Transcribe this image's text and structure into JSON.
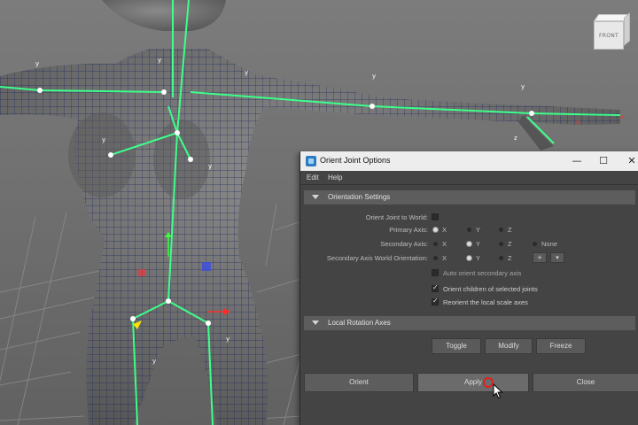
{
  "viewcube": {
    "label": "FRONT"
  },
  "dialog": {
    "title": "Orient Joint Options",
    "window_controls": {
      "minimize": "—",
      "maximize": "☐",
      "close": "✕"
    },
    "menu": [
      "Edit",
      "Help"
    ],
    "orientation_settings": {
      "header": "Orientation Settings",
      "orient_joint_to_world": {
        "label": "Orient Joint to World:",
        "checked": false
      },
      "primary_axis": {
        "label": "Primary Axis:",
        "options": [
          "X",
          "Y",
          "Z"
        ],
        "selected": "X"
      },
      "secondary_axis": {
        "label": "Secondary Axis:",
        "options": [
          "X",
          "Y",
          "Z",
          "None"
        ],
        "selected": "Y"
      },
      "secondary_axis_world_orientation": {
        "label": "Secondary Axis World Orientation:",
        "options": [
          "X",
          "Y",
          "Z"
        ],
        "selected": "Y",
        "sign": "+"
      },
      "auto_orient_secondary_axis": {
        "label": "Auto orient secondary axis",
        "checked": false
      },
      "orient_children": {
        "label": "Orient children of selected joints",
        "checked": true
      },
      "reorient_local_scale": {
        "label": "Reorient the local scale axes",
        "checked": true
      }
    },
    "local_rotation_axes": {
      "header": "Local Rotation Axes",
      "buttons": [
        "Toggle",
        "Modify",
        "Freeze"
      ]
    },
    "footer_buttons": [
      "Orient",
      "Apply",
      "Close"
    ]
  }
}
